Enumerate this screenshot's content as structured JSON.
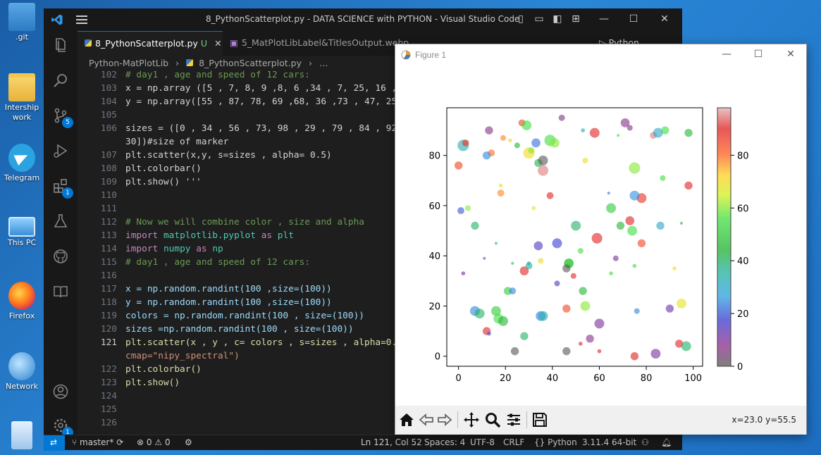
{
  "desktop": {
    "icons": [
      {
        "label": ".git"
      },
      {
        "label": "Intership work"
      },
      {
        "label": "Telegram"
      },
      {
        "label": "This PC"
      },
      {
        "label": "Firefox"
      },
      {
        "label": "Network"
      },
      {
        "label": "Recycle Bin"
      }
    ]
  },
  "vscode": {
    "title": "8_PythonScatterplot.py - DATA SCIENCE with PYTHON - Visual Studio Code",
    "tabs": [
      {
        "label": "8_PythonScatterplot.py",
        "modified": "U",
        "close": "✕"
      },
      {
        "label": "5_MatPlotLibLabel&TitlesOutput.webp"
      }
    ],
    "tab_extra": {
      "run_label": "Python"
    },
    "breadcrumb": [
      "Python-MatPlotLib",
      "8_PythonScatterplot.py",
      "…"
    ],
    "badges": {
      "source_control": "5",
      "extensions": "1",
      "settings": "1"
    },
    "line_numbers": [
      "102",
      "103",
      "104",
      "105",
      "106",
      "",
      "107",
      "108",
      "109",
      "110",
      "111",
      "112",
      "113",
      "114",
      "115",
      "116",
      "117",
      "118",
      "119",
      "120",
      "121",
      "",
      "122",
      "123",
      "124",
      "125",
      "126"
    ],
    "current_line": "121",
    "code": {
      "l102": "# day1 , age and speed of 12 cars:",
      "l103": "x = np.array ([5 , 7, 8, 9 ,8, 6 ,34 , 7, 25, 16 ,",
      "l104": "y = np.array([55 , 87, 78, 69 ,68, 36 ,73 , 47, 25",
      "l106a": "sizes = ([0 , 34 , 56 , 73, 98 , 29 , 79 , 84 , 92",
      "l106b": "30])#size of marker",
      "l107": "plt.scatter(x,y, s=sizes , alpha= 0.5)",
      "l108": "plt.colorbar()",
      "l109": "plt.show() '''",
      "l112": "# Now we will combine color , size and alpha",
      "l113_kw": "import",
      "l113_mod": "matplotlib.pyplot",
      "l113_as": "as",
      "l113_alias": "plt",
      "l114_kw": "import",
      "l114_mod": "numpy",
      "l114_as": "as",
      "l114_alias": "np",
      "l115": "# day1 , age and speed of 12 cars:",
      "l117": "x = np.random.randint(100 ,size=(100))",
      "l118": "y = np.random.randint(100 ,size=(100))",
      "l119": "colors = np.random.randint(100 , size=(100))",
      "l120": "sizes =np.random.randint(100 , size=(100))",
      "l121a": "plt.scatter(x , y , c= colors , s=sizes , alpha=0.",
      "l121b": "cmap=\"nipy_spectral\")",
      "l122": "plt.colorbar()",
      "l123": "plt.show()"
    },
    "status": {
      "branch": "master*",
      "errors": "0",
      "warnings": "0",
      "position": "Ln 121, Col 52",
      "spaces": "Spaces: 4",
      "encoding": "UTF-8",
      "eol": "CRLF",
      "language": "Python",
      "interpreter": "3.11.4 64-bit"
    }
  },
  "figure": {
    "title": "Figure 1",
    "coords": "x=23.0 y=55.5",
    "accent": "#1f77b4"
  },
  "chart_data": {
    "type": "scatter",
    "title": "",
    "xlabel": "",
    "ylabel": "",
    "xlim": [
      -5,
      104
    ],
    "ylim": [
      -4,
      99
    ],
    "xticks": [
      "0",
      "20",
      "40",
      "60",
      "80",
      "100"
    ],
    "yticks": [
      "0",
      "20",
      "40",
      "60",
      "80"
    ],
    "grid": false,
    "colormap": "nipy_spectral",
    "alpha": 0.5,
    "colorbar": {
      "ticks": [
        "0",
        "20",
        "40",
        "60",
        "80"
      ],
      "range": [
        0,
        98
      ]
    },
    "points": [
      [
        27,
        93,
        30,
        85
      ],
      [
        29,
        92,
        60,
        55
      ],
      [
        39,
        86,
        80,
        55
      ],
      [
        41,
        85,
        55,
        60
      ],
      [
        75,
        75,
        80,
        60
      ],
      [
        36,
        74,
        70,
        95
      ],
      [
        34,
        77,
        40,
        42
      ],
      [
        30,
        81,
        80,
        70
      ],
      [
        36,
        78,
        60,
        0
      ],
      [
        44,
        95,
        25,
        5
      ],
      [
        53,
        90,
        10,
        35
      ],
      [
        58,
        89,
        60,
        90
      ],
      [
        71,
        93,
        50,
        7
      ],
      [
        73,
        91,
        20,
        7
      ],
      [
        68,
        88,
        5,
        55
      ],
      [
        83,
        88,
        30,
        95
      ],
      [
        85,
        89,
        60,
        30
      ],
      [
        88,
        90,
        40,
        55
      ],
      [
        98,
        89,
        40,
        45
      ],
      [
        2,
        84,
        80,
        33
      ],
      [
        3,
        85,
        30,
        88
      ],
      [
        13,
        90,
        40,
        7
      ],
      [
        14,
        81,
        30,
        80
      ],
      [
        12,
        80,
        40,
        24
      ],
      [
        19,
        87,
        20,
        78
      ],
      [
        22,
        86,
        10,
        70
      ],
      [
        25,
        84,
        20,
        45
      ],
      [
        33,
        85,
        50,
        22
      ],
      [
        31,
        82,
        25,
        60
      ],
      [
        54,
        78,
        20,
        70
      ],
      [
        0,
        76,
        40,
        85
      ],
      [
        18,
        65,
        30,
        78
      ],
      [
        18,
        68,
        10,
        68
      ],
      [
        39,
        64,
        30,
        90
      ],
      [
        64,
        65,
        5,
        22
      ],
      [
        65,
        59,
        60,
        50
      ],
      [
        78,
        63,
        60,
        88
      ],
      [
        87,
        71,
        20,
        55
      ],
      [
        98,
        68,
        40,
        90
      ],
      [
        75,
        64,
        60,
        25
      ],
      [
        1,
        58,
        30,
        20
      ],
      [
        4,
        59,
        20,
        60
      ],
      [
        7,
        52,
        40,
        40
      ],
      [
        16,
        45,
        5,
        35
      ],
      [
        32,
        59,
        10,
        70
      ],
      [
        73,
        54,
        50,
        90
      ],
      [
        69,
        52,
        40,
        45
      ],
      [
        74,
        50,
        60,
        55
      ],
      [
        86,
        52,
        40,
        30
      ],
      [
        95,
        53,
        5,
        45
      ],
      [
        50,
        52,
        60,
        40
      ],
      [
        47,
        37,
        50,
        50
      ],
      [
        59,
        47,
        70,
        90
      ],
      [
        78,
        45,
        40,
        85
      ],
      [
        34,
        44,
        50,
        15
      ],
      [
        42,
        45,
        60,
        18
      ],
      [
        35,
        38,
        20,
        70
      ],
      [
        30,
        37,
        10,
        35
      ],
      [
        52,
        42,
        20,
        55
      ],
      [
        47,
        37,
        60,
        50
      ],
      [
        67,
        39,
        20,
        10
      ],
      [
        75,
        36,
        10,
        55
      ],
      [
        2,
        33,
        10,
        10
      ],
      [
        11,
        39,
        5,
        20
      ],
      [
        23,
        37,
        5,
        40
      ],
      [
        28,
        34,
        50,
        90
      ],
      [
        30,
        36,
        30,
        35
      ],
      [
        46,
        35,
        40,
        0
      ],
      [
        49,
        32,
        20,
        90
      ],
      [
        65,
        33,
        10,
        55
      ],
      [
        92,
        35,
        10,
        70
      ],
      [
        21,
        26,
        40,
        50
      ],
      [
        23,
        26,
        30,
        24
      ],
      [
        42,
        29,
        20,
        15
      ],
      [
        53,
        26,
        40,
        45
      ],
      [
        7,
        18,
        60,
        24
      ],
      [
        9,
        17,
        60,
        40
      ],
      [
        16,
        18,
        60,
        50
      ],
      [
        17,
        15,
        60,
        55
      ],
      [
        35,
        16,
        60,
        24
      ],
      [
        36,
        16,
        60,
        33
      ],
      [
        54,
        20,
        60,
        60
      ],
      [
        46,
        19,
        40,
        85
      ],
      [
        76,
        18,
        20,
        24
      ],
      [
        90,
        19,
        40,
        12
      ],
      [
        95,
        21,
        60,
        68
      ],
      [
        12,
        10,
        40,
        90
      ],
      [
        13,
        9,
        10,
        20
      ],
      [
        19,
        14,
        60,
        45
      ],
      [
        28,
        8,
        40,
        40
      ],
      [
        52,
        5,
        10,
        90
      ],
      [
        60,
        13,
        60,
        10
      ],
      [
        56,
        7,
        40,
        8
      ],
      [
        60,
        2,
        10,
        90
      ],
      [
        24,
        2,
        40,
        0
      ],
      [
        46,
        2,
        40,
        0
      ],
      [
        75,
        0,
        40,
        90
      ],
      [
        84,
        1,
        60,
        10
      ],
      [
        94,
        5,
        40,
        90
      ],
      [
        97,
        4,
        60,
        40
      ]
    ]
  }
}
